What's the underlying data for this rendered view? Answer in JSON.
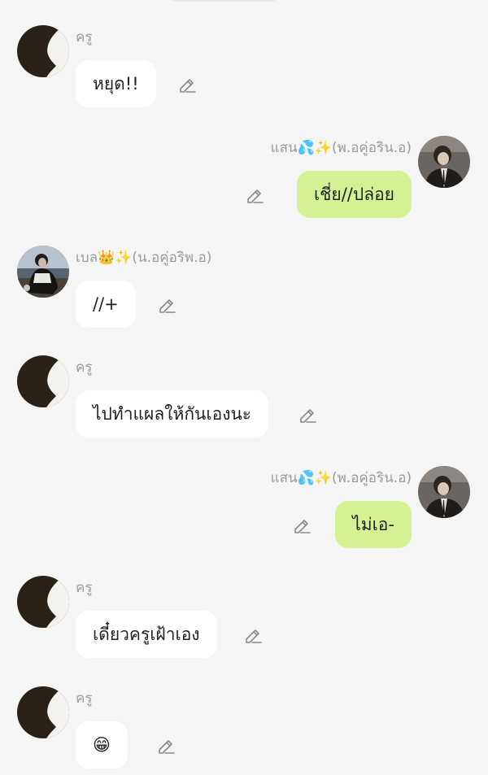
{
  "colors": {
    "background": "#f5f5f5",
    "incoming_bubble": "#ffffff",
    "outgoing_bubble": "#d4f294",
    "sender_name": "#9b9b9b",
    "icon": "#8a8a8a"
  },
  "messages": [
    {
      "side": "left",
      "sender": "ครู",
      "text": "หยุด!!",
      "avatar": "silhouette-avatar"
    },
    {
      "side": "right",
      "sender": "แสน💦✨(พ.อคู่อริน.อ)",
      "text": "เชี่ย//ปล่อย",
      "avatar": "photo-avatar"
    },
    {
      "side": "left",
      "sender": "เบล👑✨(น.อคู่อริพ.อ)",
      "text": "//+",
      "avatar": "photo-avatar"
    },
    {
      "side": "left",
      "sender": "ครู",
      "text": "ไปทำแผลให้กันเองนะ",
      "avatar": "silhouette-avatar"
    },
    {
      "side": "right",
      "sender": "แสน💦✨(พ.อคู่อริน.อ)",
      "text": "ไม่เอ-",
      "avatar": "photo-avatar"
    },
    {
      "side": "left",
      "sender": "ครู",
      "text": "เดี๋ยวครูเฝ้าเอง",
      "avatar": "silhouette-avatar"
    },
    {
      "side": "left",
      "sender": "ครู",
      "text": "😁",
      "avatar": "silhouette-avatar"
    }
  ],
  "edit_icon": "pencil-icon"
}
